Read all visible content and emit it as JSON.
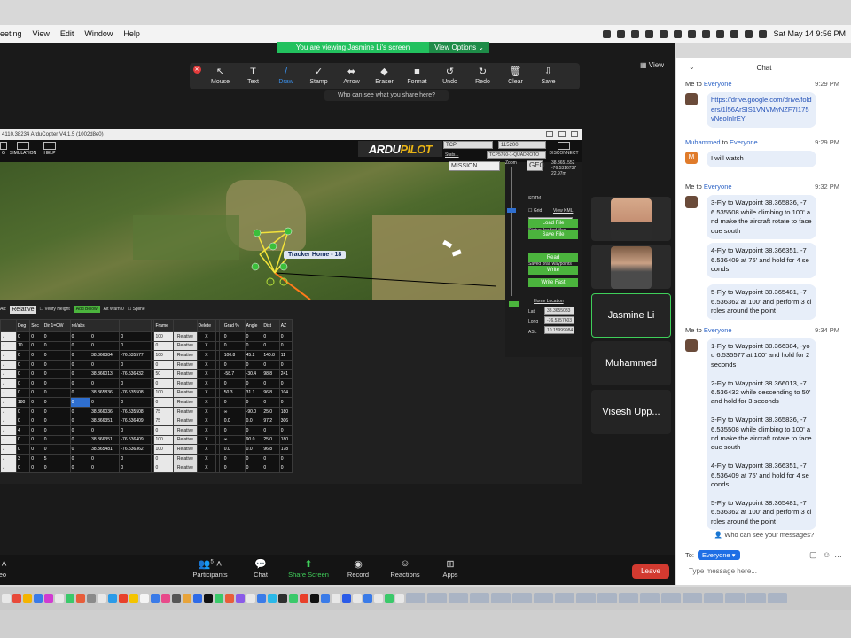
{
  "menubar": {
    "items": [
      "eeting",
      "View",
      "Edit",
      "Window",
      "Help"
    ],
    "datetime": "Sat May 14  9:56 PM"
  },
  "banner": {
    "text": "You are viewing Jasmine Li's screen",
    "view_options": "View Options ⌄"
  },
  "view_button": "View",
  "toolbar": {
    "tools": [
      {
        "label": "Mouse",
        "icon": "cursor-icon",
        "glyph": "↖"
      },
      {
        "label": "Text",
        "icon": "text-icon",
        "glyph": "T"
      },
      {
        "label": "Draw",
        "icon": "pen-icon",
        "glyph": "/"
      },
      {
        "label": "Stamp",
        "icon": "check-icon",
        "glyph": "✓"
      },
      {
        "label": "Arrow",
        "icon": "arrow-icon",
        "glyph": "⬌"
      },
      {
        "label": "Eraser",
        "icon": "eraser-icon",
        "glyph": "◆"
      },
      {
        "label": "Format",
        "icon": "format-icon",
        "glyph": "■"
      },
      {
        "label": "Undo",
        "icon": "undo-icon",
        "glyph": "↺"
      },
      {
        "label": "Redo",
        "icon": "redo-icon",
        "glyph": "↻"
      },
      {
        "label": "Clear",
        "icon": "trash-icon",
        "glyph": "🗑"
      },
      {
        "label": "Save",
        "icon": "save-icon",
        "glyph": "⇩"
      }
    ],
    "who_can_see": "Who can see what you share here?"
  },
  "shared": {
    "titlebar": "4110.38234 ArduCopter V4.1.5 (1002d8e0)",
    "header_buttons": [
      "G",
      "SIMULATION",
      "HELP"
    ],
    "logo_a": "ARDU",
    "logo_b": "PILOT",
    "tcp": "TCP",
    "baud": "115200",
    "link": "TCP5760-1-QUADROTO",
    "stats": "Stats...",
    "mission": "MISSION",
    "disconnect": "DISCONNECT",
    "geo": "GEO",
    "srtm": "SRTM",
    "coords": [
      "38.3651552",
      "-76.5316737",
      "22.97m"
    ],
    "zoom": "Zoom",
    "grid_label": "Grid",
    "view_kml": "View KML",
    "map_type": "GoogleSatelliteMa",
    "status": "Status: loaded tiles",
    "load_file": "Load File",
    "save_file": "Save File",
    "saved_msg": "Saved prac waypoints",
    "read": "Read",
    "write": "Write",
    "write_fast": "Write Fast",
    "home_location": "Home Location",
    "lat_label": "Lat",
    "lat": "38.3655083",
    "long_label": "Long",
    "long": "-76.5357603",
    "asl_label": "ASL",
    "asl": "10.15999984",
    "tracker": "Tracker Home - 18",
    "alt_label": "Alt:",
    "relative": "Relative",
    "verify_height": "Verify Height",
    "add_below": "Add Below",
    "alt_warn": "Alt Warn",
    "alt_warn_val": "0",
    "spline": "Spline"
  },
  "grid": {
    "headers": [
      "",
      "Deg",
      "Sec",
      "Dir 1=CW",
      "rel/abs",
      "",
      "",
      "",
      "Frame",
      "",
      "Delete",
      "",
      "",
      "Grad %",
      "Angle",
      "Dist",
      "AZ"
    ],
    "rows": [
      [
        "0",
        "0",
        "0",
        "0",
        "0",
        "0",
        "",
        "100",
        "Relative",
        "X",
        "",
        "",
        "0",
        "0",
        "0",
        "0"
      ],
      [
        "10",
        "0",
        "0",
        "0",
        "0",
        "0",
        "",
        "0",
        "Relative",
        "X",
        "",
        "",
        "0",
        "0",
        "0",
        "0"
      ],
      [
        "0",
        "0",
        "0",
        "0",
        "38.366384",
        "-76.535577",
        "",
        "100",
        "Relative",
        "X",
        "",
        "",
        "100.8",
        "45.2",
        "140.8",
        "11"
      ],
      [
        "0",
        "0",
        "0",
        "0",
        "0",
        "0",
        "",
        "0",
        "Relative",
        "X",
        "",
        "",
        "0",
        "0",
        "0",
        "0"
      ],
      [
        "0",
        "0",
        "0",
        "0",
        "38.366013",
        "-76.536432",
        "",
        "50",
        "Relative",
        "X",
        "",
        "",
        "-58.7",
        "-30.4",
        "98.8",
        "241"
      ],
      [
        "0",
        "0",
        "0",
        "0",
        "0",
        "0",
        "",
        "0",
        "Relative",
        "X",
        "",
        "",
        "0",
        "0",
        "0",
        "0"
      ],
      [
        "0",
        "0",
        "0",
        "0",
        "38.365836",
        "-76.535508",
        "",
        "100",
        "Relative",
        "X",
        "",
        "",
        "50.3",
        "31.1",
        "96.8",
        "104"
      ],
      [
        "180",
        "0",
        "0",
        "0",
        "0",
        "0",
        "",
        "0",
        "Relative",
        "X",
        "",
        "",
        "0",
        "0",
        "0",
        "0"
      ],
      [
        "0",
        "0",
        "0",
        "0",
        "38.366036",
        "-76.535508",
        "",
        "75",
        "Relative",
        "X",
        "",
        "",
        "∞",
        "-90.0",
        "25.0",
        "180"
      ],
      [
        "0",
        "0",
        "0",
        "0",
        "38.366351",
        "-76.536409",
        "",
        "75",
        "Relative",
        "X",
        "",
        "",
        "0.0",
        "0.0",
        "97.2",
        "306"
      ],
      [
        "4",
        "0",
        "0",
        "0",
        "0",
        "0",
        "",
        "0",
        "Relative",
        "X",
        "",
        "",
        "0",
        "0",
        "0",
        "0"
      ],
      [
        "0",
        "0",
        "0",
        "0",
        "38.366351",
        "-76.536409",
        "",
        "100",
        "Relative",
        "X",
        "",
        "",
        "∞",
        "90.0",
        "25.0",
        "180"
      ],
      [
        "0",
        "0",
        "0",
        "0",
        "38.365481",
        "-76.536362",
        "",
        "100",
        "Relative",
        "X",
        "",
        "",
        "0.0",
        "0.0",
        "96.8",
        "178"
      ],
      [
        "3",
        "0",
        "5",
        "0",
        "0",
        "0",
        "",
        "0",
        "Relative",
        "X",
        "",
        "",
        "0",
        "0",
        "0",
        "0"
      ],
      [
        "0",
        "0",
        "0",
        "0",
        "0",
        "0",
        "",
        "0",
        "Relative",
        "X",
        "",
        "",
        "0",
        "0",
        "0",
        "0"
      ]
    ]
  },
  "tiles": [
    "Jasmine Li",
    "Muhammed",
    "Visesh Upp..."
  ],
  "bottombar": {
    "video": "ideo",
    "participants": "Participants",
    "participants_count": "5",
    "chat": "Chat",
    "share": "Share Screen",
    "record": "Record",
    "reactions": "Reactions",
    "apps": "Apps",
    "leave": "Leave"
  },
  "chat": {
    "title": "Chat",
    "messages": [
      {
        "from": "Me",
        "to": "Everyone",
        "time": "9:29 PM",
        "text": "https://drive.google.com/drive/folders/1l56ArSIS1VNVMyNZF7I175vNeoInIrEY",
        "link": true
      },
      {
        "from": "Muhammed",
        "to": "Everyone",
        "time": "9:29 PM",
        "text": "I will watch",
        "avatar": "M"
      },
      {
        "from": "Me",
        "to": "Everyone",
        "time": "9:32 PM",
        "text": "3-Fly to Waypoint 38.365836, -76.535508 while climbing to 100' and make the aircraft rotate to face due south"
      },
      {
        "text": "4-Fly to Waypoint 38.366351, -76.536409 at 75' and hold for 4 seconds"
      },
      {
        "text": "5-Fly to Waypoint 38.365481, -76.536362 at 100' and perform 3 circles around the point"
      },
      {
        "from": "Me",
        "to": "Everyone",
        "time": "9:34 PM",
        "text": "1-Fly to Waypoint 38.366384, -you 6.535577 at 100' and hold for 2 seconds\n\n2-Fly to Waypoint 38.366013, -76.536432 while descending to 50' and hold for 3 seconds\n\n3-Fly to Waypoint 38.365836, -76.535508 while climbing to 100' and make the aircraft rotate to face due south\n\n4-Fly to Waypoint 38.366351, -76.536409 at 75' and hold for 4 seconds\n\n5-Fly to Waypoint 38.365481, -76.536362 at 100' and perform 3 circles around the point"
      }
    ],
    "who_can_see": "Who can see your messages?",
    "to_label": "To:",
    "to_value": "Everyone ▾",
    "placeholder": "Type message here..."
  }
}
